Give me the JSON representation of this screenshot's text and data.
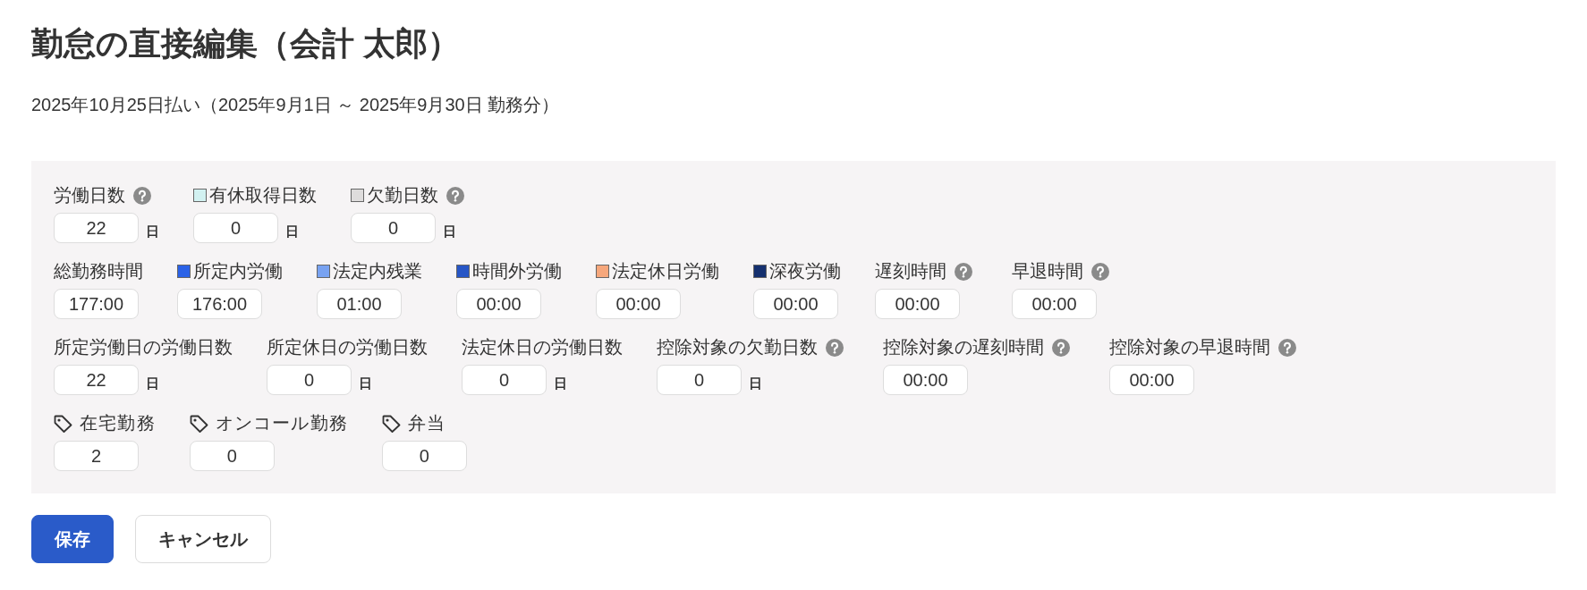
{
  "header": {
    "title": "勤怠の直接編集（会計 太郎）",
    "subtitle": "2025年10月25日払い（2025年9月1日 ～ 2025年9月30日 勤務分）"
  },
  "form": {
    "rows": [
      {
        "fields": [
          {
            "kind": "plain",
            "label": "労働日数",
            "help": true,
            "value": "22",
            "unit": "日"
          },
          {
            "kind": "swatch",
            "color": "#d2f1f1",
            "label": "有休取得日数",
            "help": false,
            "value": "0",
            "unit": "日"
          },
          {
            "kind": "swatch",
            "color": "#dedcdc",
            "label": "欠勤日数",
            "help": true,
            "value": "0",
            "unit": "日"
          }
        ]
      },
      {
        "fields": [
          {
            "kind": "plain",
            "label": "総勤務時間",
            "help": false,
            "value": "177:00"
          },
          {
            "kind": "swatch",
            "color": "#2b62e7",
            "label": "所定内労働",
            "help": false,
            "value": "176:00"
          },
          {
            "kind": "swatch",
            "color": "#78a2f1",
            "label": "法定内残業",
            "help": false,
            "value": "01:00"
          },
          {
            "kind": "swatch",
            "color": "#2756c6",
            "label": "時間外労働",
            "help": false,
            "value": "00:00"
          },
          {
            "kind": "swatch",
            "color": "#f6a77c",
            "label": "法定休日労働",
            "help": false,
            "value": "00:00"
          },
          {
            "kind": "swatch",
            "color": "#15306f",
            "label": "深夜労働",
            "help": false,
            "value": "00:00"
          },
          {
            "kind": "plain",
            "label": "遅刻時間",
            "help": true,
            "value": "00:00"
          },
          {
            "kind": "plain",
            "label": "早退時間",
            "help": true,
            "value": "00:00"
          }
        ]
      },
      {
        "fields": [
          {
            "kind": "plain",
            "label": "所定労働日の労働日数",
            "help": false,
            "value": "22",
            "unit": "日"
          },
          {
            "kind": "plain",
            "label": "所定休日の労働日数",
            "help": false,
            "value": "0",
            "unit": "日"
          },
          {
            "kind": "plain",
            "label": "法定休日の労働日数",
            "help": false,
            "value": "0",
            "unit": "日"
          },
          {
            "kind": "plain",
            "label": "控除対象の欠勤日数",
            "help": true,
            "value": "0",
            "unit": "日"
          },
          {
            "kind": "plain",
            "label": "控除対象の遅刻時間",
            "help": true,
            "value": "00:00"
          },
          {
            "kind": "plain",
            "label": "控除対象の早退時間",
            "help": true,
            "value": "00:00"
          }
        ]
      },
      {
        "fields": [
          {
            "kind": "tag",
            "label": "在宅勤務",
            "help": false,
            "value": "2"
          },
          {
            "kind": "tag",
            "label": "オンコール勤務",
            "help": false,
            "value": "0"
          },
          {
            "kind": "tag",
            "label": "弁当",
            "help": false,
            "value": "0"
          }
        ]
      }
    ]
  },
  "buttons": [
    {
      "kind": "primary",
      "label": "保存"
    },
    {
      "kind": "secondary",
      "label": "キャンセル"
    }
  ]
}
